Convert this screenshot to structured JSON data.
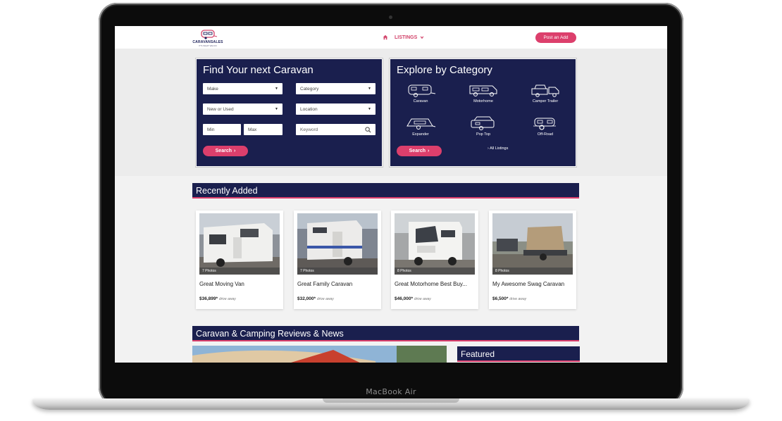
{
  "device": {
    "model_label": "MacBook Air"
  },
  "brand": {
    "logo_text": "CARAVANSALES",
    "logo_tagline": "IT'S WHAT WE DO"
  },
  "nav": {
    "listings_label": "LISTINGS",
    "post_button": "Post an Add"
  },
  "find_panel": {
    "title": "Find Your next Caravan",
    "make": "Make",
    "category": "Category",
    "condition": "New or Used",
    "location": "Location",
    "min": "Min",
    "max": "Max",
    "keyword_placeholder": "Keyword",
    "search_button": "Search"
  },
  "explore_panel": {
    "title": "Explore by Category",
    "categories": [
      "Caravan",
      "Motorhome",
      "Camper Trailer",
      "Expander",
      "Pop Top",
      "Off-Road"
    ],
    "search_button": "Search",
    "all_listings": "All Listings"
  },
  "recently_added": {
    "heading": "Recently Added",
    "listings": [
      {
        "photos": "7 Photos",
        "title": "Great Moving Van",
        "price": "$36,899*",
        "price_note": "drive away"
      },
      {
        "photos": "7 Photos",
        "title": "Great Family Caravan",
        "price": "$32,000*",
        "price_note": "drive away"
      },
      {
        "photos": "8 Photos",
        "title": "Great Motorhome Best Buy...",
        "price": "$46,000*",
        "price_note": "drive away"
      },
      {
        "photos": "8 Photos",
        "title": "My Awesome Swag Caravan",
        "price": "$6,500*",
        "price_note": "drive away"
      }
    ]
  },
  "reviews": {
    "heading": "Caravan & Camping Reviews & News",
    "featured": "Featured"
  },
  "colors": {
    "navy": "#1a1f4e",
    "pink": "#dc3f6c",
    "background": "#f2f2f2"
  }
}
